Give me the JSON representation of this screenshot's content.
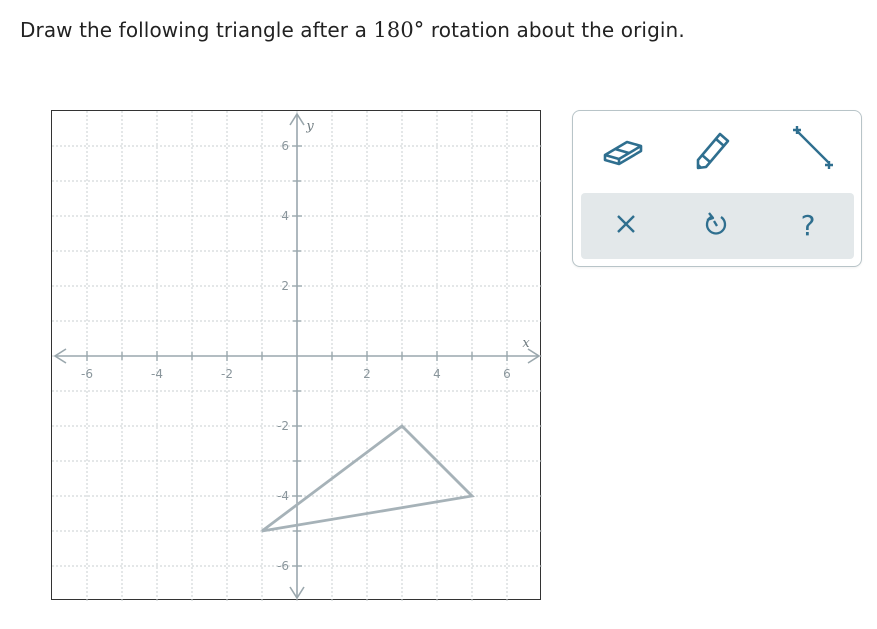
{
  "question": {
    "text_before": "Draw the following triangle after a ",
    "math": "180°",
    "text_after": " rotation about the origin."
  },
  "graph": {
    "x_axis_label": "x",
    "y_axis_label": "y",
    "x_range": [
      -6,
      6
    ],
    "y_range": [
      -6,
      6
    ],
    "grid_step": 1,
    "x_tick_labels": [
      {
        "value": -6,
        "label": "-6"
      },
      {
        "value": -4,
        "label": "-4"
      },
      {
        "value": -2,
        "label": "-2"
      },
      {
        "value": 2,
        "label": "2"
      },
      {
        "value": 4,
        "label": "4"
      },
      {
        "value": 6,
        "label": "6"
      }
    ],
    "y_tick_labels": [
      {
        "value": 6,
        "label": "6"
      },
      {
        "value": 4,
        "label": "4"
      },
      {
        "value": 2,
        "label": "2"
      },
      {
        "value": -2,
        "label": "-2"
      },
      {
        "value": -4,
        "label": "-4"
      },
      {
        "value": -6,
        "label": "-6"
      }
    ],
    "triangle_vertices": [
      [
        3,
        -2
      ],
      [
        5,
        -4
      ],
      [
        -1,
        -5
      ]
    ],
    "triangle_color": "#a6b2b8"
  },
  "toolbox": {
    "tools": [
      {
        "name": "eraser-tool",
        "icon": "eraser-icon"
      },
      {
        "name": "pencil-tool",
        "icon": "pencil-icon"
      },
      {
        "name": "line-segment-tool",
        "icon": "line-segment-icon"
      }
    ],
    "actions": [
      {
        "name": "clear-button",
        "icon": "close-icon"
      },
      {
        "name": "undo-button",
        "icon": "undo-icon"
      },
      {
        "name": "help-button",
        "icon": "help-icon",
        "glyph": "?"
      }
    ],
    "icon_color": "#2f6f8f",
    "action_bar_color": "#e3e8ea"
  }
}
